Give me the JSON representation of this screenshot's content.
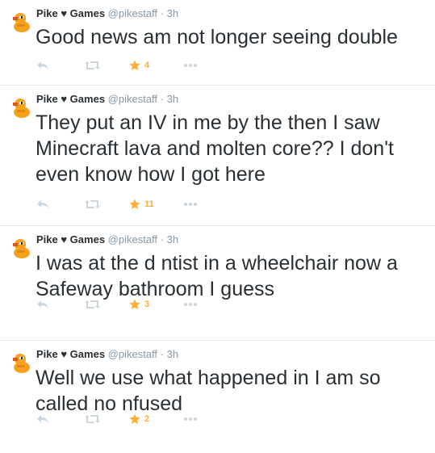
{
  "tweets": [
    {
      "author": "Pike ♥ Games",
      "handle": "@pikestaff",
      "separator": "·",
      "time": "3h",
      "text": "Good news am not longer seeing double",
      "favorites": "4"
    },
    {
      "author": "Pike ♥ Games",
      "handle": "@pikestaff",
      "separator": "·",
      "time": "3h",
      "text": "They put an IV in me by the then I saw Minecraft lava and molten core?? I don't even know how I got here",
      "favorites": "11"
    },
    {
      "author": "Pike ♥ Games",
      "handle": "@pikestaff",
      "separator": "·",
      "time": "3h",
      "text": "I was at the d ntist in a wheelchair now a Safeway bathroom I guess",
      "favorites": "3"
    },
    {
      "author": "Pike ♥ Games",
      "handle": "@pikestaff",
      "separator": "·",
      "time": "3h",
      "text": "Well we use what happened in I am so called no nfused",
      "favorites": "2"
    }
  ],
  "colors": {
    "favorite_active": "#ffac33",
    "muted": "#8899a6",
    "icon_gray": "#ccd6dd",
    "divider": "#e1e8ed"
  },
  "icons": {
    "avatar": "duck-avatar-icon",
    "reply": "reply-arrow-icon",
    "retweet": "retweet-icon",
    "favorite": "star-icon",
    "more": "more-dots-icon"
  }
}
